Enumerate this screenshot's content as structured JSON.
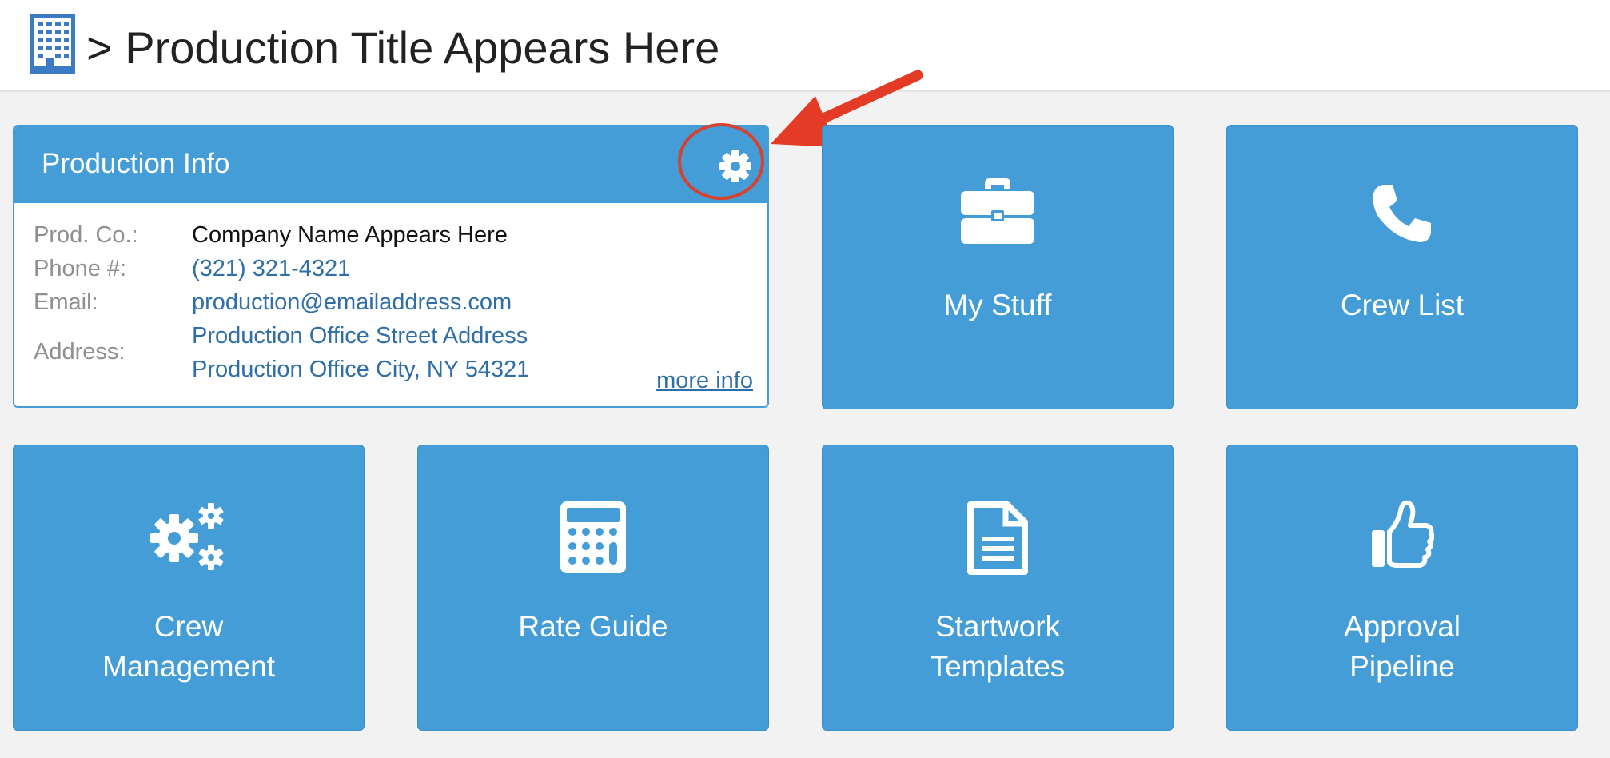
{
  "header": {
    "icon": "building-icon",
    "title": "> Production Title Appears Here"
  },
  "production_info": {
    "title": "Production Info",
    "settings_icon": "gear-icon",
    "rows": {
      "prod_co": {
        "label": "Prod. Co.:",
        "value": "Company Name Appears Here"
      },
      "phone": {
        "label": "Phone #:",
        "value": "(321) 321-4321"
      },
      "email": {
        "label": "Email:",
        "value": "production@emailaddress.com"
      },
      "address": {
        "label": "Address:",
        "line1": "Production Office Street Address",
        "line2": "Production Office City, NY 54321"
      }
    },
    "more_info": "more info"
  },
  "tiles": {
    "my_stuff": {
      "label": "My Stuff",
      "icon": "briefcase-icon"
    },
    "crew_list": {
      "label": "Crew List",
      "icon": "phone-icon"
    },
    "crew_management": {
      "line1": "Crew",
      "line2": "Management",
      "icon": "gears-icon"
    },
    "rate_guide": {
      "label": "Rate Guide",
      "icon": "calculator-icon"
    },
    "startwork_templates": {
      "line1": "Startwork",
      "line2": "Templates",
      "icon": "document-icon"
    },
    "approval_pipeline": {
      "line1": "Approval",
      "line2": "Pipeline",
      "icon": "thumbs-up-icon"
    }
  },
  "colors": {
    "tile_blue": "#449dd6",
    "link_blue": "#2f6ea9",
    "annotation_red": "#d9412e",
    "background": "#f2f2f2"
  }
}
